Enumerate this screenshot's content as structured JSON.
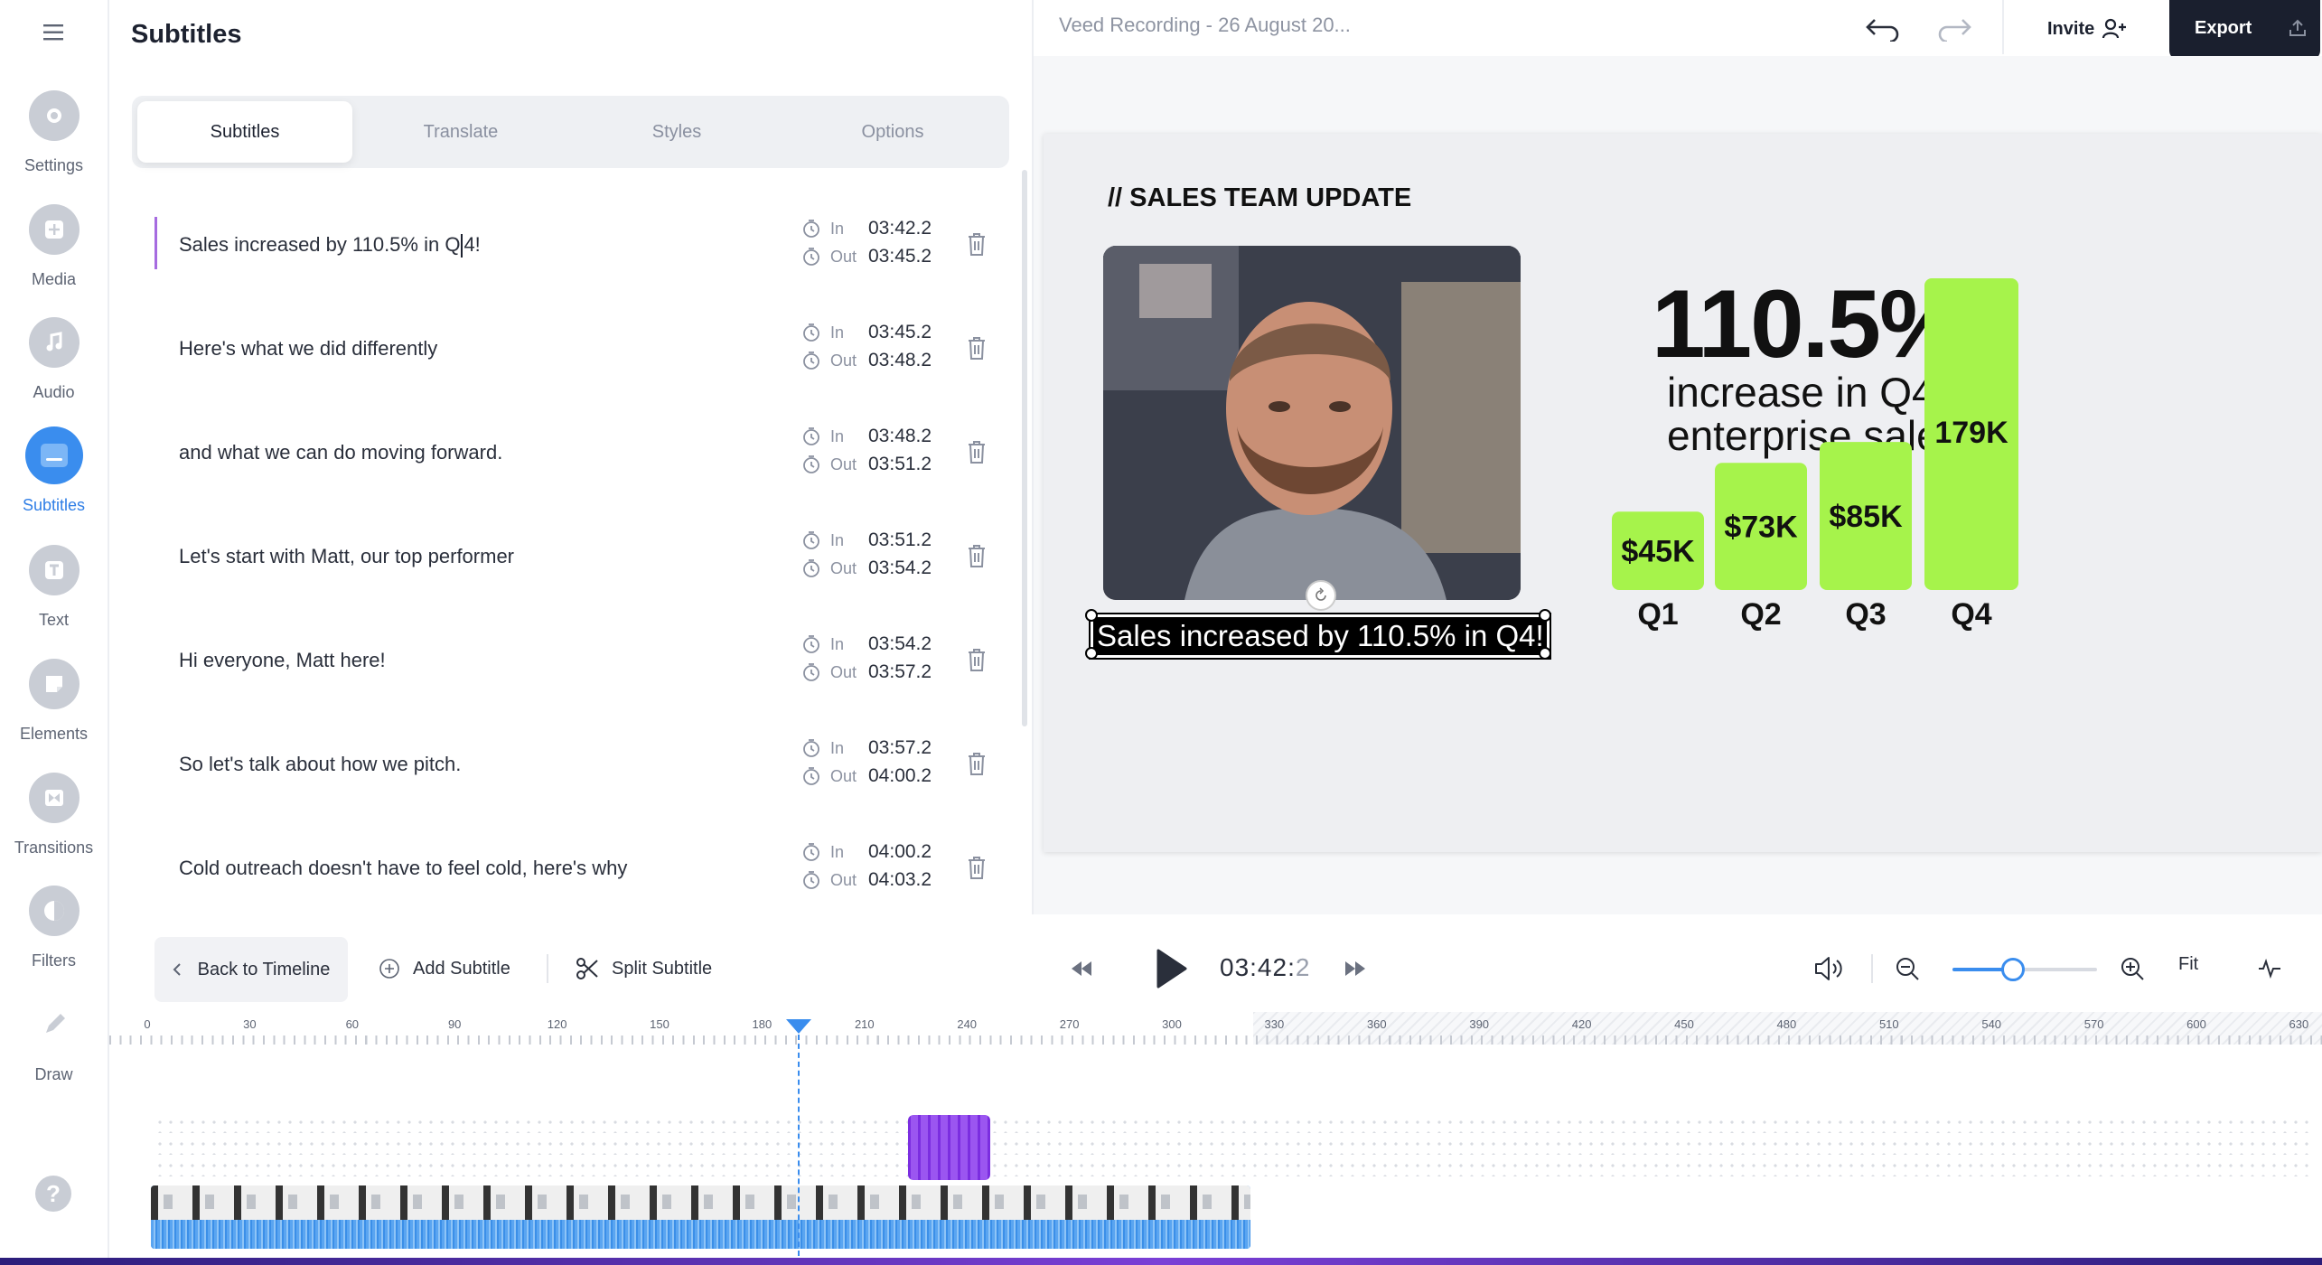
{
  "rail": {
    "items": [
      {
        "label": "Settings",
        "icon": "settings-icon"
      },
      {
        "label": "Media",
        "icon": "media-icon"
      },
      {
        "label": "Audio",
        "icon": "audio-icon"
      },
      {
        "label": "Subtitles",
        "icon": "subtitles-icon"
      },
      {
        "label": "Text",
        "icon": "text-icon"
      },
      {
        "label": "Elements",
        "icon": "elements-icon"
      },
      {
        "label": "Transitions",
        "icon": "transitions-icon"
      },
      {
        "label": "Filters",
        "icon": "filters-icon"
      },
      {
        "label": "Draw",
        "icon": "draw-icon"
      }
    ],
    "active": "Subtitles",
    "help": "?"
  },
  "panel": {
    "title": "Subtitles",
    "tabs": [
      "Subtitles",
      "Translate",
      "Styles",
      "Options"
    ],
    "active_tab": "Subtitles",
    "in_label": "In",
    "out_label": "Out",
    "rows": [
      {
        "text_before": "Sales increased by 110.5% in Q",
        "text_after": "4!",
        "in": "03:42.2",
        "out": "03:45.2"
      },
      {
        "text_before": "Here's what we did differently",
        "text_after": "",
        "in": "03:45.2",
        "out": "03:48.2"
      },
      {
        "text_before": "and what we can do moving forward.",
        "text_after": "",
        "in": "03:48.2",
        "out": "03:51.2"
      },
      {
        "text_before": "Let's start with Matt, our top performer",
        "text_after": "",
        "in": "03:51.2",
        "out": "03:54.2"
      },
      {
        "text_before": "Hi everyone, Matt here!",
        "text_after": "",
        "in": "03:54.2",
        "out": "03:57.2"
      },
      {
        "text_before": "So let's talk about how we pitch.",
        "text_after": "",
        "in": "03:57.2",
        "out": "04:00.2"
      },
      {
        "text_before": "Cold outreach doesn't have to feel cold, here's why",
        "text_after": "",
        "in": "04:00.2",
        "out": "04:03.2"
      }
    ]
  },
  "header": {
    "doc_title": "Veed Recording - 26 August 20...",
    "invite_label": "Invite",
    "export_label": "Export"
  },
  "slide": {
    "heading": "// SALES TEAM UPDATE",
    "caption": "Sales increased by 110.5% in Q4!",
    "stat_big": "110.5%",
    "stat_sub": "increase in Q4 enterprise sales",
    "bar_color": "#a6f34b"
  },
  "chart_data": {
    "type": "bar",
    "categories": [
      "Q1",
      "Q2",
      "Q3",
      "Q4"
    ],
    "values": [
      45,
      73,
      85,
      179
    ],
    "value_labels": [
      "$45K",
      "$73K",
      "$85K",
      "179K"
    ]
  },
  "toolbar": {
    "back_label": "Back to Timeline",
    "add_label": "Add Subtitle",
    "split_label": "Split Subtitle",
    "time_main": "03:42:",
    "time_dim": "2",
    "zoom_level": 0.42,
    "fit_label": "Fit"
  },
  "timeline": {
    "ticks": [
      "0",
      "30",
      "60",
      "90",
      "120",
      "150",
      "180",
      "210",
      "240",
      "270",
      "300",
      "330",
      "360",
      "390",
      "420",
      "450",
      "480",
      "510",
      "540",
      "570",
      "600",
      "630"
    ]
  },
  "colors": {
    "accent": "#3a8dee",
    "subtitle_clip": "#8a3ee8",
    "active_row_accent": "#a66be0"
  }
}
